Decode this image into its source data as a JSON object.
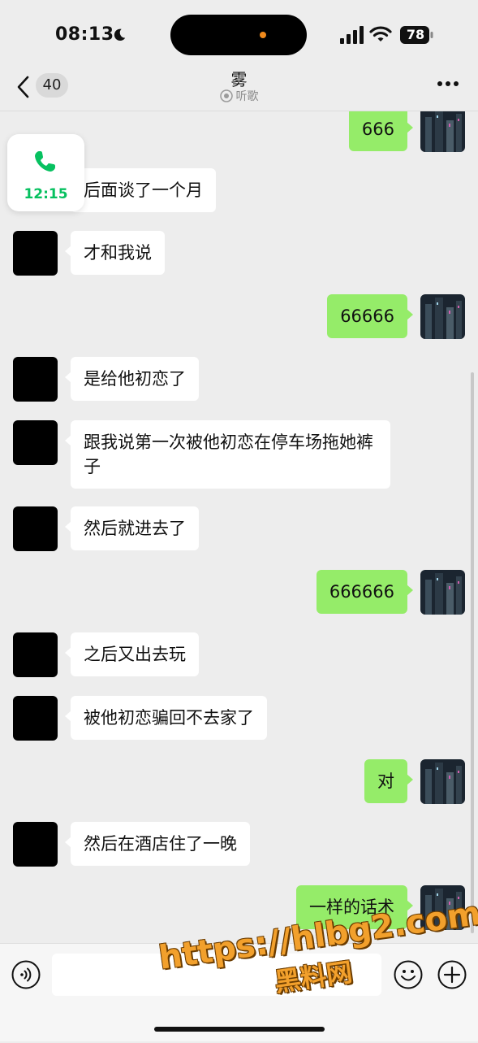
{
  "status_bar": {
    "time": "08:13",
    "battery_level": "78",
    "icons": [
      "moon-icon",
      "signal-icon",
      "wifi-icon",
      "battery-icon"
    ]
  },
  "header": {
    "unread_count": "40",
    "title": "雾",
    "subtitle": "听歌",
    "icons": [
      "back-icon",
      "listen-icon",
      "more-icon"
    ]
  },
  "call_widget": {
    "duration": "12:15",
    "icon": "phone-icon"
  },
  "messages": [
    {
      "side": "right",
      "text": "666"
    },
    {
      "side": "left",
      "text": "后面谈了一个月"
    },
    {
      "side": "left",
      "text": "才和我说"
    },
    {
      "side": "right",
      "text": "66666"
    },
    {
      "side": "left",
      "text": "是给他初恋了"
    },
    {
      "side": "left",
      "text": "跟我说第一次被他初恋在停车场拖她裤子"
    },
    {
      "side": "left",
      "text": "然后就进去了"
    },
    {
      "side": "right",
      "text": "666666"
    },
    {
      "side": "left",
      "text": "之后又出去玩"
    },
    {
      "side": "left",
      "text": "被他初恋骗回不去家了"
    },
    {
      "side": "right",
      "text": "对"
    },
    {
      "side": "left",
      "text": "然后在酒店住了一晚"
    },
    {
      "side": "right",
      "text": "一样的话术"
    }
  ],
  "input_bar": {
    "placeholder": "",
    "icons": [
      "voice-icon",
      "emoji-icon",
      "plus-icon"
    ]
  },
  "watermark": {
    "url": "https://hlbg2.com",
    "name": "黑料网"
  },
  "colors": {
    "background": "#ededed",
    "sent_bubble": "#95ec69",
    "received_bubble": "#ffffff",
    "call_accent": "#07c160"
  }
}
